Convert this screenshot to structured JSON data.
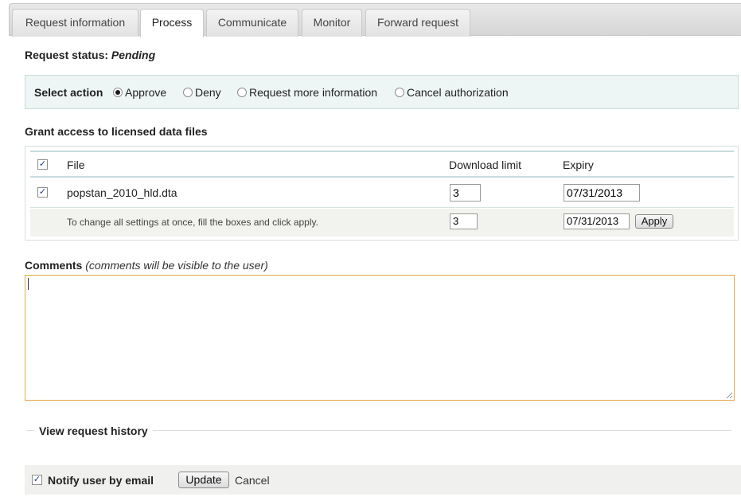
{
  "tabs": [
    {
      "label": "Request information"
    },
    {
      "label": "Process"
    },
    {
      "label": "Communicate"
    },
    {
      "label": "Monitor"
    },
    {
      "label": "Forward request"
    }
  ],
  "status": {
    "label": "Request status:",
    "value": "Pending"
  },
  "action": {
    "label": "Select action",
    "options": [
      "Approve",
      "Deny",
      "Request more information",
      "Cancel authorization"
    ],
    "selected": "Approve"
  },
  "grant": {
    "title": "Grant access to licensed data files",
    "headers": {
      "file": "File",
      "limit": "Download limit",
      "expiry": "Expiry"
    },
    "rows": [
      {
        "file": "popstan_2010_hld.dta",
        "limit": "3",
        "expiry": "07/31/2013",
        "checked": true
      }
    ],
    "bulk": {
      "hint": "To change all settings at once, fill the boxes and click apply.",
      "limit": "3",
      "expiry": "07/31/2013",
      "apply_label": "Apply"
    }
  },
  "comments": {
    "label": "Comments",
    "hint": "(comments will be visible to the user)",
    "value": ""
  },
  "history": {
    "label": "View request history"
  },
  "footer": {
    "notify_label": "Notify user by email",
    "update_label": "Update",
    "cancel_label": "Cancel"
  },
  "check_glyph": "✓"
}
